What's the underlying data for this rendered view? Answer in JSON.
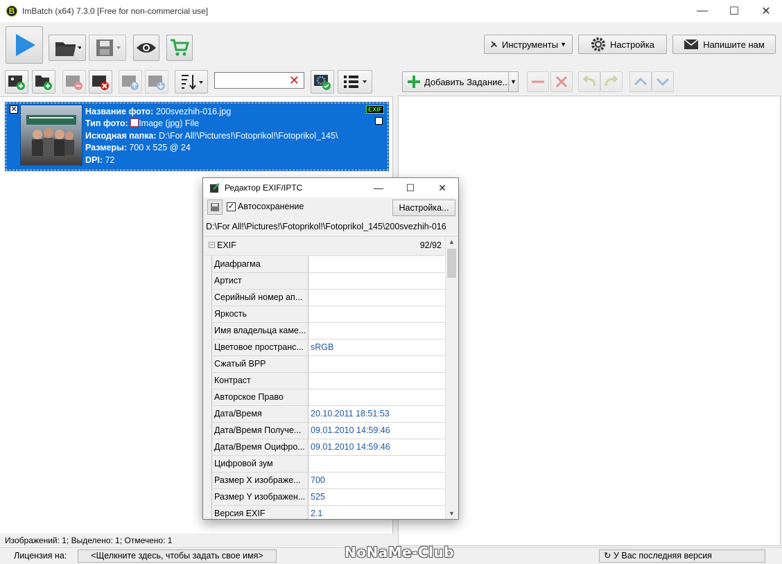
{
  "window": {
    "title": "ImBatch (x64) 7.3.0 [Free for non-commercial use]",
    "logo_letter": "B",
    "controls": [
      "—",
      "☐",
      "✕"
    ]
  },
  "main_toolbar": {
    "buttons": {
      "tools": "Инструменты",
      "settings": "Настройка",
      "contact": "Напишите нам"
    }
  },
  "left_panel": {
    "search": {
      "value": "",
      "placeholder": ""
    },
    "photo": {
      "name_label": "Название фото:",
      "name_value": "200svezhih-016.jpg",
      "type_label": "Тип фото:",
      "type_value": "Image (jpg) File",
      "folder_label": "Исходная папка:",
      "folder_value": "D:\\For All!\\Pictures!\\Fotoprikol!\\Fotoprikol_145\\",
      "size_label": "Размеры:",
      "size_value": "700 x 525 @ 24",
      "dpi_label": "DPI:",
      "dpi_value": "72",
      "exif_badge": "EXIF"
    },
    "status": "Изображений: 1; Выделено: 1; Отмечено: 1"
  },
  "right_panel": {
    "add_task": "Добавить Задание..."
  },
  "bottom_bar": {
    "license_label": "Лицензия на:",
    "license_value": "<Щелкните здесь, чтобы задать свое имя>",
    "watermark": "NoNaMe-Club",
    "version": "У Вас последняя версия"
  },
  "exif_dialog": {
    "title": "Редактор EXIF/IPTC",
    "autosave": "Автосохранение",
    "autosave_checked": true,
    "settings_button": "Настройка...",
    "path": "D:\\For All!\\Pictures!\\Fotoprikol!\\Fotoprikol_145\\200svezhih-016",
    "group": "EXIF",
    "group_count": "92/92",
    "rows": [
      {
        "k": "Диафрагма",
        "v": ""
      },
      {
        "k": "Артист",
        "v": ""
      },
      {
        "k": "Серийный номер ап...",
        "v": ""
      },
      {
        "k": "Яркость",
        "v": ""
      },
      {
        "k": "Имя владельца каме...",
        "v": ""
      },
      {
        "k": "Цветовое пространс...",
        "v": "sRGB"
      },
      {
        "k": "Сжатый BPP",
        "v": ""
      },
      {
        "k": "Контраст",
        "v": ""
      },
      {
        "k": "Авторское Право",
        "v": ""
      },
      {
        "k": "Дата/Время",
        "v": "20.10.2011 18:51:53"
      },
      {
        "k": "Дата/Время Получе...",
        "v": "09.01.2010 14:59:46"
      },
      {
        "k": "Дата/Время Оцифро...",
        "v": "09.01.2010 14:59:46"
      },
      {
        "k": "Цифровой зум",
        "v": ""
      },
      {
        "k": "Размер X изображе...",
        "v": "700"
      },
      {
        "k": "Размер Y изображен...",
        "v": "525"
      },
      {
        "k": "Версия EXIF",
        "v": "2.1"
      }
    ]
  },
  "colors": {
    "selection_blue": "#0e6fd6",
    "accent_green": "#2aa84a",
    "play_blue": "#2b8de0",
    "value_blue": "#1b56a6",
    "delete_red": "#d41818"
  }
}
